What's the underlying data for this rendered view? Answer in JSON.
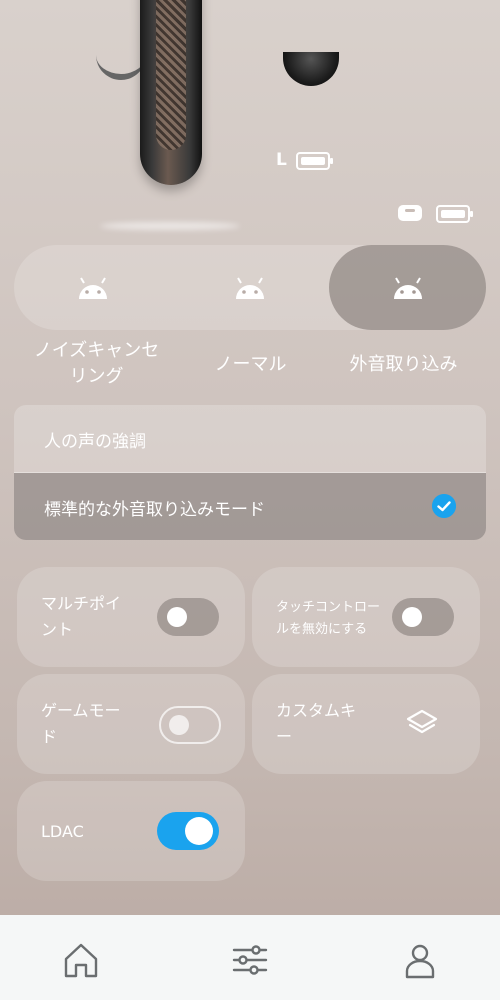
{
  "device": {
    "left_label": "L"
  },
  "modes": [
    {
      "label": "ノイズキャンセリング",
      "line1": "ノイズキャンセ",
      "line2": "リング",
      "active": false
    },
    {
      "label": "ノーマル",
      "active": false
    },
    {
      "label": "外音取り込み",
      "active": true
    }
  ],
  "ambient_options": [
    {
      "label": "人の声の強調",
      "selected": false
    },
    {
      "label": "標準的な外音取り込みモード",
      "selected": true
    }
  ],
  "features": {
    "multipoint": {
      "line1": "マルチポイ",
      "line2": "ント",
      "on": false
    },
    "disable_touch": {
      "line1": "タッチコントロー",
      "line2": "ルを無効にする",
      "on": false
    },
    "game_mode": {
      "line1": "ゲームモー",
      "line2": "ド",
      "on": false,
      "enabled": false
    },
    "custom_keys": {
      "line1": "カスタムキ",
      "line2": "ー",
      "icon": "layers-icon"
    },
    "ldac": {
      "label": "LDAC",
      "on": true
    }
  },
  "nav": [
    "home-icon",
    "equalizer-icon",
    "profile-icon"
  ],
  "colors": {
    "accent": "#1aa3ee",
    "nav_bg": "#f5f7f7",
    "nav_icon": "#6a6e70"
  }
}
